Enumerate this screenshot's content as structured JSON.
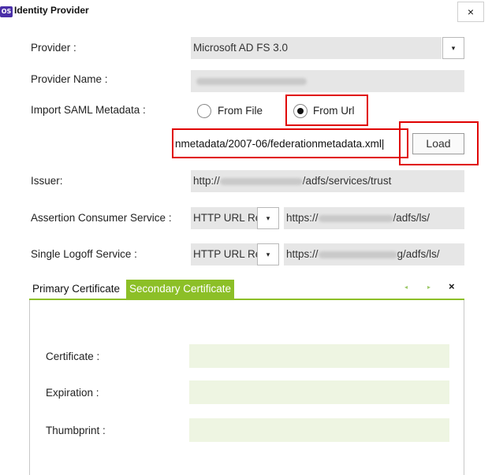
{
  "window": {
    "badge": "OS",
    "title": "Identity Provider",
    "close_symbol": "×"
  },
  "form": {
    "provider_label": "Provider :",
    "provider_value": "Microsoft AD FS 3.0",
    "provider_dropdown_symbol": "▾",
    "provider_name_label": "Provider Name :",
    "import_label": "Import SAML Metadata :",
    "radio_from_file": "From File",
    "radio_from_url": "From Url",
    "radio_selected": "From Url",
    "url_value": "nmetadata/2007-06/federationmetadata.xml",
    "load_button": "Load",
    "issuer_label": "Issuer:",
    "issuer_prefix": "http://",
    "issuer_suffix": "/adfs/services/trust",
    "acs_label": "Assertion Consumer Service :",
    "acs_binding": "HTTP URL Rec",
    "acs_url_prefix": "https://",
    "acs_url_suffix": "/adfs/ls/",
    "slo_label": "Single Logoff Service :",
    "slo_binding": "HTTP URL Rec",
    "slo_url_prefix": "https://",
    "slo_url_suffix": "g/adfs/ls/"
  },
  "cert_tabs": {
    "tabs": [
      "Primary Certificate",
      "Secondary Certificate"
    ],
    "active_tab": "Secondary Certificate",
    "prev_symbol": "◂",
    "next_symbol": "▸",
    "close_symbol": "×",
    "certificate_label": "Certificate :",
    "expiration_label": "Expiration :",
    "thumbprint_label": "Thumbprint :"
  },
  "colors": {
    "accent_green": "#8cbf27",
    "highlight_red": "#e00000",
    "badge_purple": "#4a2fa8"
  }
}
